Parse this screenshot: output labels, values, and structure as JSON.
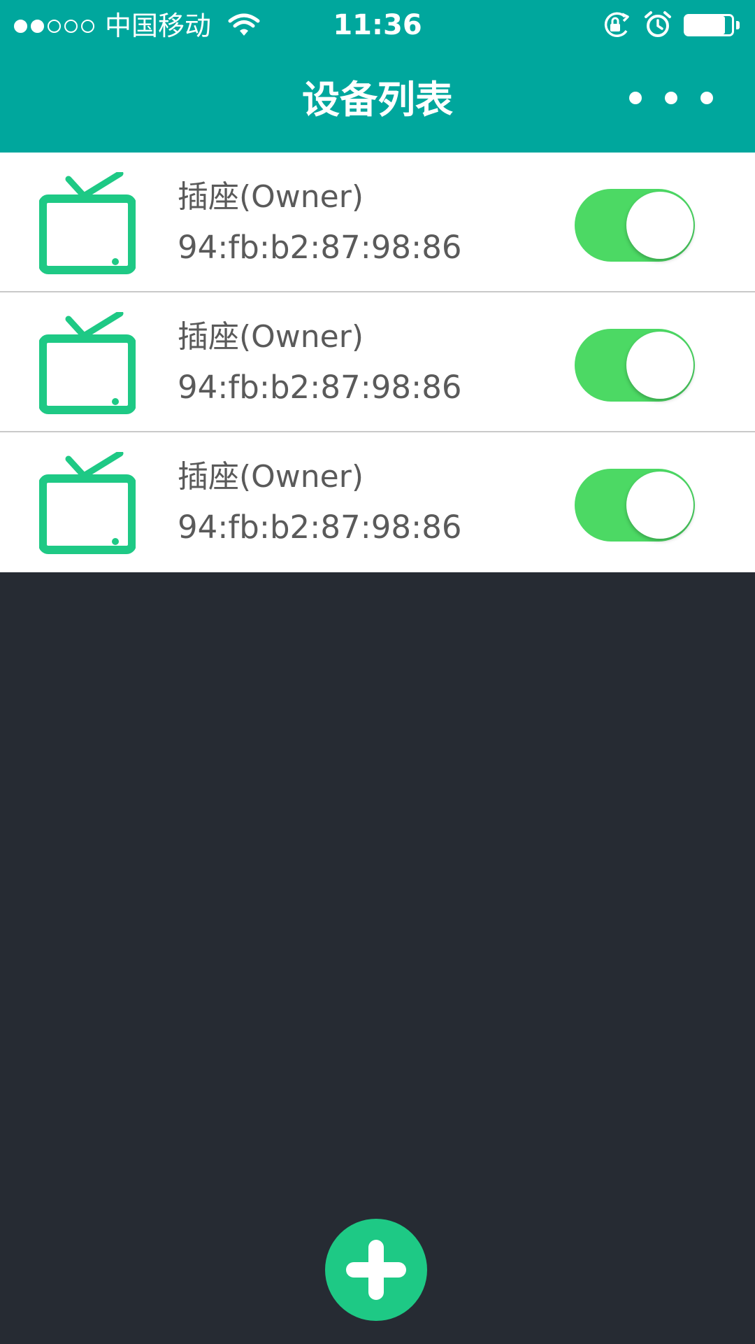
{
  "status_bar": {
    "signal_filled": 2,
    "signal_total": 5,
    "carrier": "中国移动",
    "time": "11:36",
    "battery_level": 0.85
  },
  "nav": {
    "title": "设备列表",
    "more_icon": "more-dots-icon"
  },
  "devices": [
    {
      "name": "插座(Owner)",
      "mac": "94:fb:b2:87:98:86",
      "on": true
    },
    {
      "name": "插座(Owner)",
      "mac": "94:fb:b2:87:98:86",
      "on": true
    },
    {
      "name": "插座(Owner)",
      "mac": "94:fb:b2:87:98:86",
      "on": true
    }
  ],
  "colors": {
    "header": "#00a79d",
    "device_icon": "#1ec985",
    "toggle_on": "#4cd964",
    "background": "#262b33",
    "add_button": "#1ec985"
  },
  "add_button": {
    "icon": "plus-icon"
  }
}
